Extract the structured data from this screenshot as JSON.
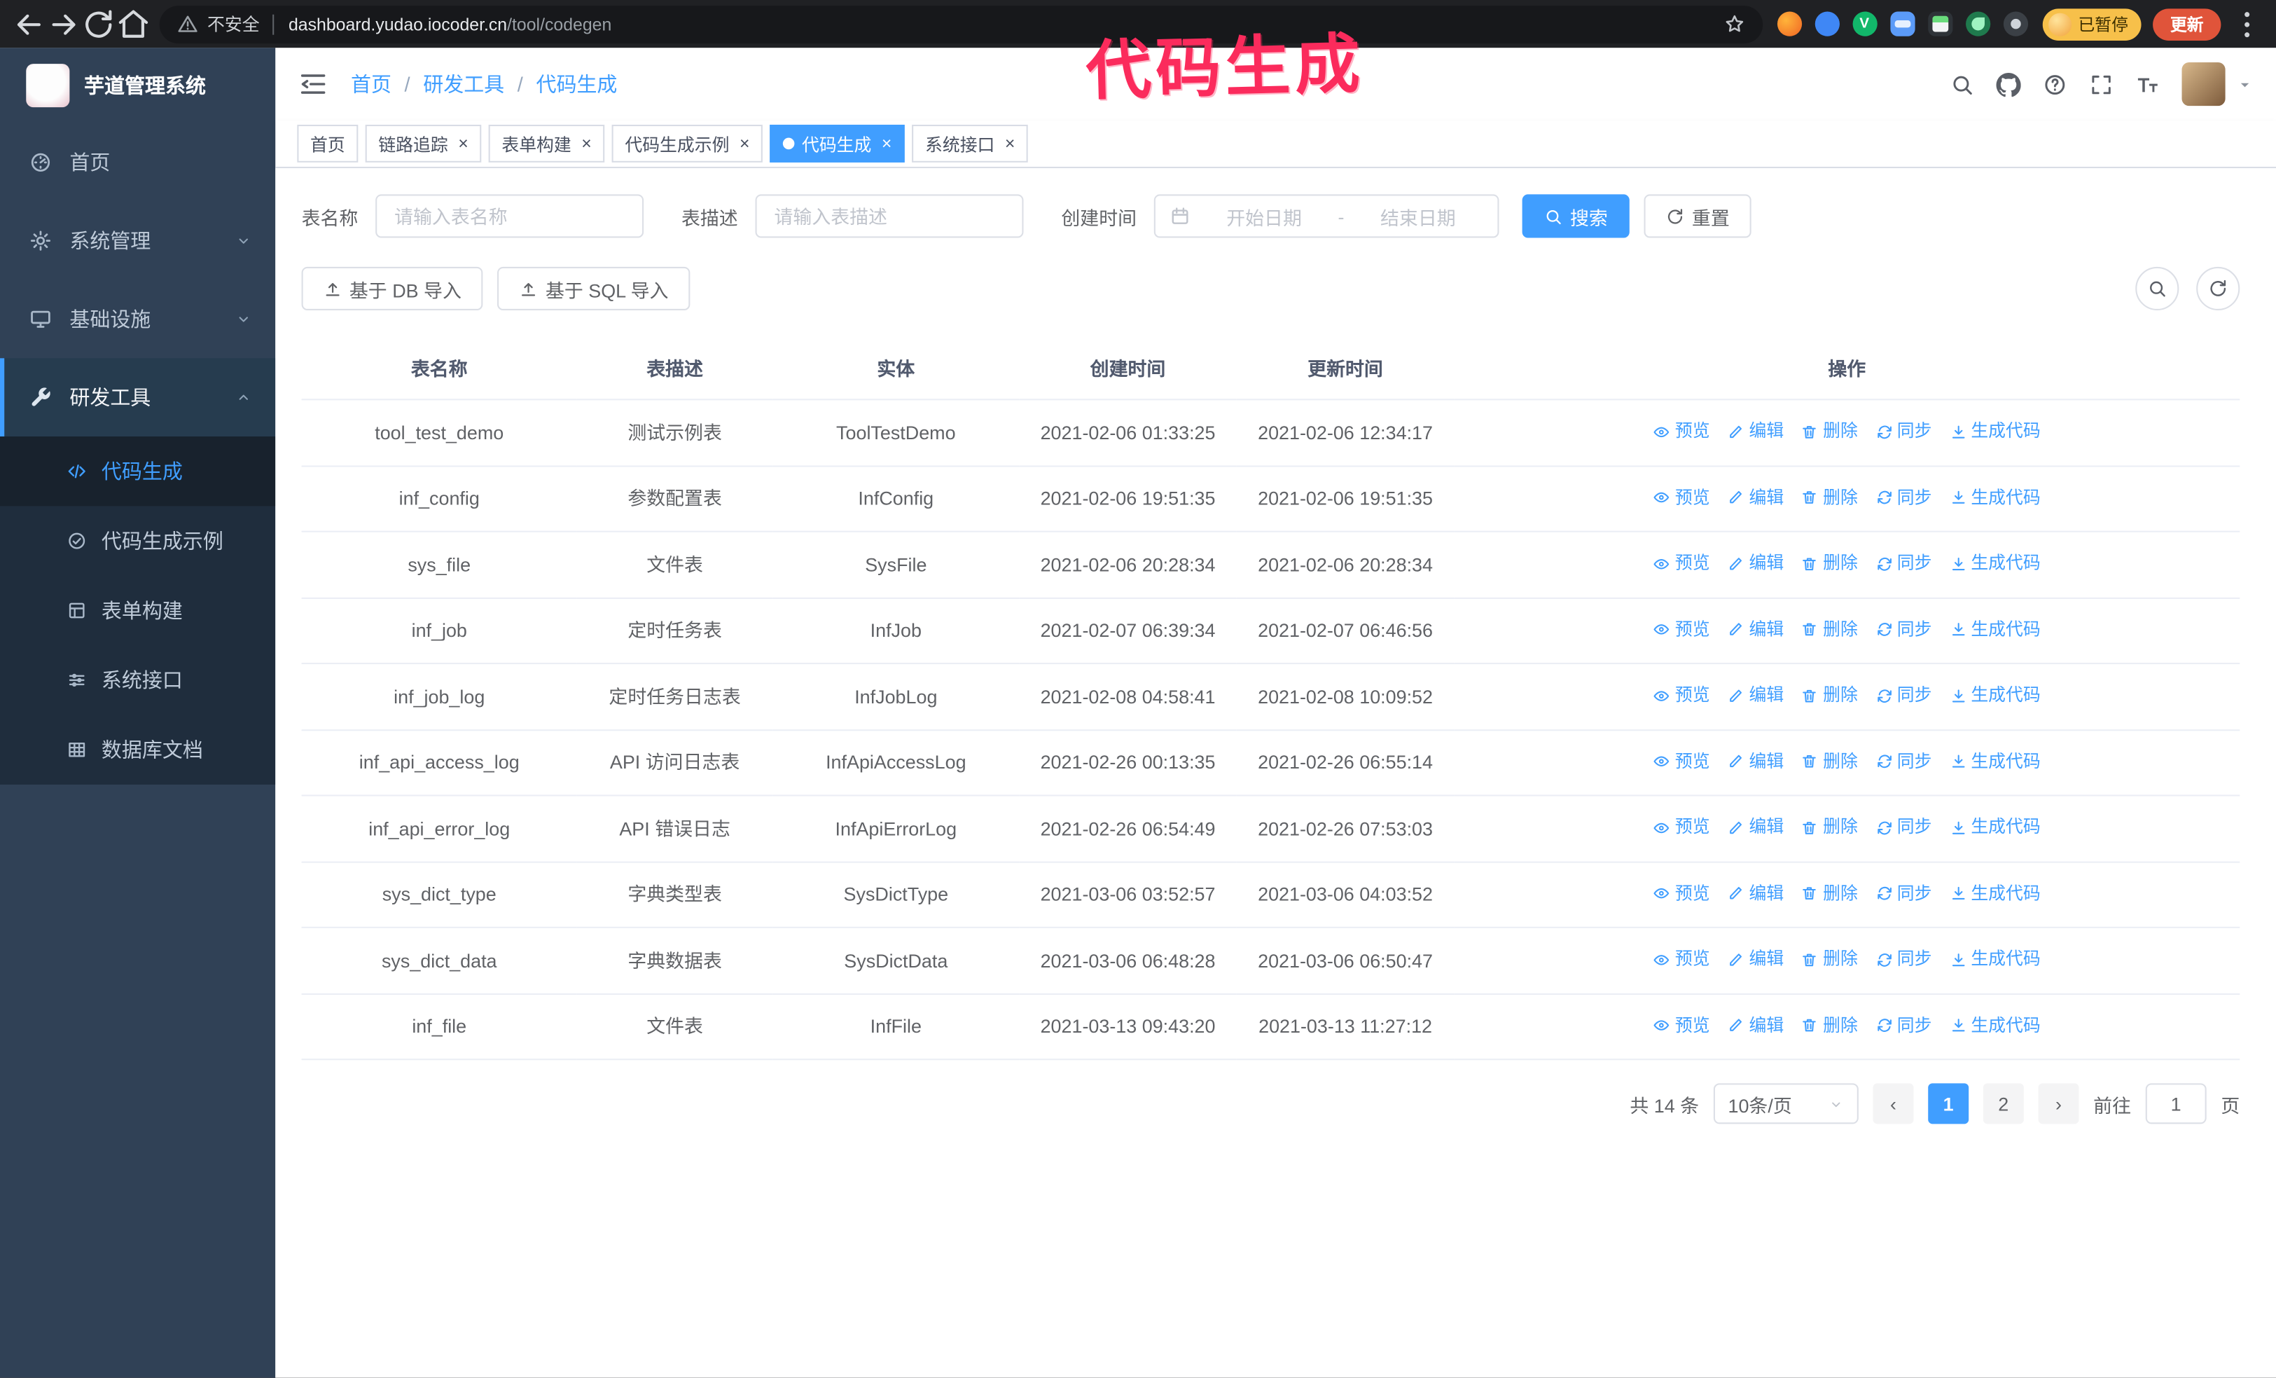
{
  "browser": {
    "security_label": "不安全",
    "url_domain": "dashboard.yudao.iocoder.cn",
    "url_path": "/tool/codegen",
    "profile_badge": "已暂停",
    "update_button": "更新"
  },
  "annotation": {
    "text": "代码生成"
  },
  "sidebar": {
    "logo_title": "芋道管理系统",
    "items": [
      {
        "label": "首页",
        "icon": "dashboard-icon"
      },
      {
        "label": "系统管理",
        "icon": "gear-icon"
      },
      {
        "label": "基础设施",
        "icon": "monitor-icon"
      },
      {
        "label": "研发工具",
        "icon": "tool-icon",
        "expanded": true,
        "children": [
          {
            "label": "代码生成",
            "icon": "code-icon",
            "active": true
          },
          {
            "label": "代码生成示例",
            "icon": "check-circle-icon"
          },
          {
            "label": "表单构建",
            "icon": "form-icon"
          },
          {
            "label": "系统接口",
            "icon": "sliders-icon"
          },
          {
            "label": "数据库文档",
            "icon": "table-grid-icon"
          }
        ]
      }
    ]
  },
  "header": {
    "breadcrumb": [
      "首页",
      "研发工具",
      "代码生成"
    ],
    "breadcrumb_separator": "/"
  },
  "tabs": [
    {
      "label": "首页",
      "closable": false,
      "active": false
    },
    {
      "label": "链路追踪",
      "closable": true,
      "active": false
    },
    {
      "label": "表单构建",
      "closable": true,
      "active": false
    },
    {
      "label": "代码生成示例",
      "closable": true,
      "active": false
    },
    {
      "label": "代码生成",
      "closable": true,
      "active": true
    },
    {
      "label": "系统接口",
      "closable": true,
      "active": false
    }
  ],
  "filters": {
    "table_name_label": "表名称",
    "table_name_placeholder": "请输入表名称",
    "table_desc_label": "表描述",
    "table_desc_placeholder": "请输入表描述",
    "create_time_label": "创建时间",
    "date_start_placeholder": "开始日期",
    "date_separator": "-",
    "date_end_placeholder": "结束日期",
    "search_button": "搜索",
    "reset_button": "重置"
  },
  "toolbar": {
    "import_db_button": "基于 DB 导入",
    "import_sql_button": "基于 SQL 导入"
  },
  "table": {
    "columns": [
      "表名称",
      "表描述",
      "实体",
      "创建时间",
      "更新时间",
      "操作"
    ],
    "actions": [
      "预览",
      "编辑",
      "删除",
      "同步",
      "生成代码"
    ],
    "rows": [
      {
        "name": "tool_test_demo",
        "desc": "测试示例表",
        "entity": "ToolTestDemo",
        "create_time": "2021-02-06 01:33:25",
        "update_time": "2021-02-06 12:34:17"
      },
      {
        "name": "inf_config",
        "desc": "参数配置表",
        "entity": "InfConfig",
        "create_time": "2021-02-06 19:51:35",
        "update_time": "2021-02-06 19:51:35"
      },
      {
        "name": "sys_file",
        "desc": "文件表",
        "entity": "SysFile",
        "create_time": "2021-02-06 20:28:34",
        "update_time": "2021-02-06 20:28:34"
      },
      {
        "name": "inf_job",
        "desc": "定时任务表",
        "entity": "InfJob",
        "create_time": "2021-02-07 06:39:34",
        "update_time": "2021-02-07 06:46:56"
      },
      {
        "name": "inf_job_log",
        "desc": "定时任务日志表",
        "entity": "InfJobLog",
        "create_time": "2021-02-08 04:58:41",
        "update_time": "2021-02-08 10:09:52"
      },
      {
        "name": "inf_api_access_log",
        "desc": "API 访问日志表",
        "entity": "InfApiAccessLog",
        "create_time": "2021-02-26 00:13:35",
        "update_time": "2021-02-26 06:55:14"
      },
      {
        "name": "inf_api_error_log",
        "desc": "API 错误日志",
        "entity": "InfApiErrorLog",
        "create_time": "2021-02-26 06:54:49",
        "update_time": "2021-02-26 07:53:03"
      },
      {
        "name": "sys_dict_type",
        "desc": "字典类型表",
        "entity": "SysDictType",
        "create_time": "2021-03-06 03:52:57",
        "update_time": "2021-03-06 04:03:52"
      },
      {
        "name": "sys_dict_data",
        "desc": "字典数据表",
        "entity": "SysDictData",
        "create_time": "2021-03-06 06:48:28",
        "update_time": "2021-03-06 06:50:47"
      },
      {
        "name": "inf_file",
        "desc": "文件表",
        "entity": "InfFile",
        "create_time": "2021-03-13 09:43:20",
        "update_time": "2021-03-13 11:27:12"
      }
    ]
  },
  "pagination": {
    "total_text": "共 14 条",
    "page_size": "10条/页",
    "pages": [
      "1",
      "2"
    ],
    "active_page": "1",
    "goto_label": "前往",
    "goto_value": "1",
    "goto_suffix": "页"
  },
  "colors": {
    "primary": "#409eff",
    "sidebar_bg": "#304156",
    "submenu_bg": "#1f2d3d",
    "annotation": "#fb2b5c",
    "active_tab": "#409eff"
  }
}
